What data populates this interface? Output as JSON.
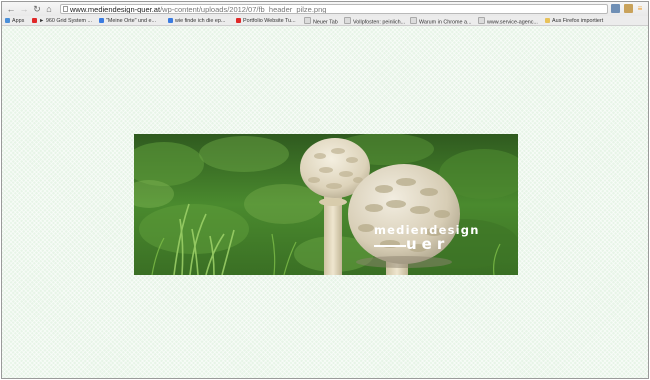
{
  "browser": {
    "url_domain": "www.mediendesign-quer.at",
    "url_path": "/wp-content/uploads/2012/07/fb_header_pilze.png"
  },
  "bookmarks": [
    {
      "label": "Apps",
      "icon": "apps-grid-icon",
      "color": "#4a8fd8"
    },
    {
      "label": "► 960 Grid System ...",
      "icon": "youtube-icon",
      "color": "#e02828"
    },
    {
      "label": "\"Meine Orte\" und e...",
      "icon": "google-icon",
      "color": "#3a7be0"
    },
    {
      "label": "wie finde ich die ep...",
      "icon": "google-search-icon",
      "color": "#3a7be0"
    },
    {
      "label": "Portfolio Website Tu...",
      "icon": "youtube-icon",
      "color": "#e02828"
    },
    {
      "label": "Neuer Tab",
      "icon": "page-icon",
      "color": "#dcdcdc"
    },
    {
      "label": "Vollpfosten: peinlich...",
      "icon": "page-icon",
      "color": "#dcdcdc"
    },
    {
      "label": "Warum in Chrome a...",
      "icon": "page-icon",
      "color": "#dcdcdc"
    },
    {
      "label": "www.service-agenc...",
      "icon": "page-icon",
      "color": "#dcdcdc"
    },
    {
      "label": "Aus Firefox importiert",
      "icon": "folder-icon",
      "color": "#e8c25a"
    }
  ],
  "image": {
    "brand_top": "mediendesign",
    "brand_bottom": "uer"
  }
}
